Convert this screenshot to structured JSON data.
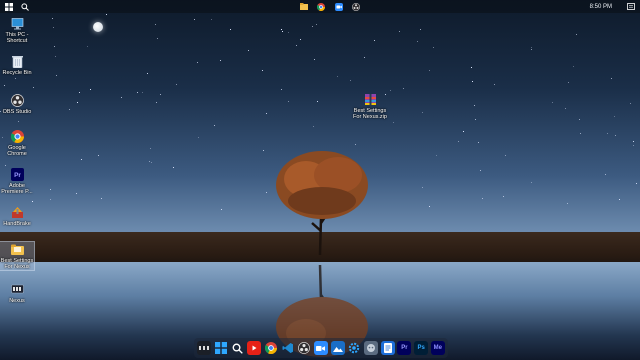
{
  "top_bar": {
    "clock": "8:50 PM"
  },
  "desktop_icons": [
    {
      "label": "This PC - Shortcut",
      "icon": "computer-icon"
    },
    {
      "label": "Recycle Bin",
      "icon": "recycle-bin-icon"
    },
    {
      "label": "OBS Studio",
      "icon": "obs-studio-icon"
    },
    {
      "label": "Google Chrome",
      "icon": "chrome-icon"
    },
    {
      "label": "Adobe Premiere P...",
      "icon": "premiere-pro-icon"
    },
    {
      "label": "HandBrake",
      "icon": "handbrake-icon"
    },
    {
      "label": "Best Settings For Nexus",
      "icon": "folder-icon"
    },
    {
      "label": "Nexus",
      "icon": "nexus-icon"
    },
    {
      "label": "Best Settings For Nexus.zip",
      "icon": "winrar-archive-icon"
    }
  ],
  "dock": {
    "items": [
      {
        "name": "nexus",
        "label": ""
      },
      {
        "name": "start",
        "label": ""
      },
      {
        "name": "search",
        "label": ""
      },
      {
        "name": "youtube",
        "label": ""
      },
      {
        "name": "chrome",
        "label": ""
      },
      {
        "name": "vscode",
        "label": ""
      },
      {
        "name": "obs",
        "label": ""
      },
      {
        "name": "zoom",
        "label": ""
      },
      {
        "name": "photos",
        "label": ""
      },
      {
        "name": "settings",
        "label": ""
      },
      {
        "name": "discord",
        "label": ""
      },
      {
        "name": "docs",
        "label": ""
      },
      {
        "name": "premiere",
        "label": "Pr"
      },
      {
        "name": "photoshop",
        "label": "Ps"
      },
      {
        "name": "media-encoder",
        "label": "Me"
      }
    ]
  },
  "colors": {
    "sky_top": "#0e1a2a",
    "sky_bottom": "#7c9bbd",
    "tree_foliage": "#8a4a22",
    "dock_bg": "#1e283a"
  }
}
